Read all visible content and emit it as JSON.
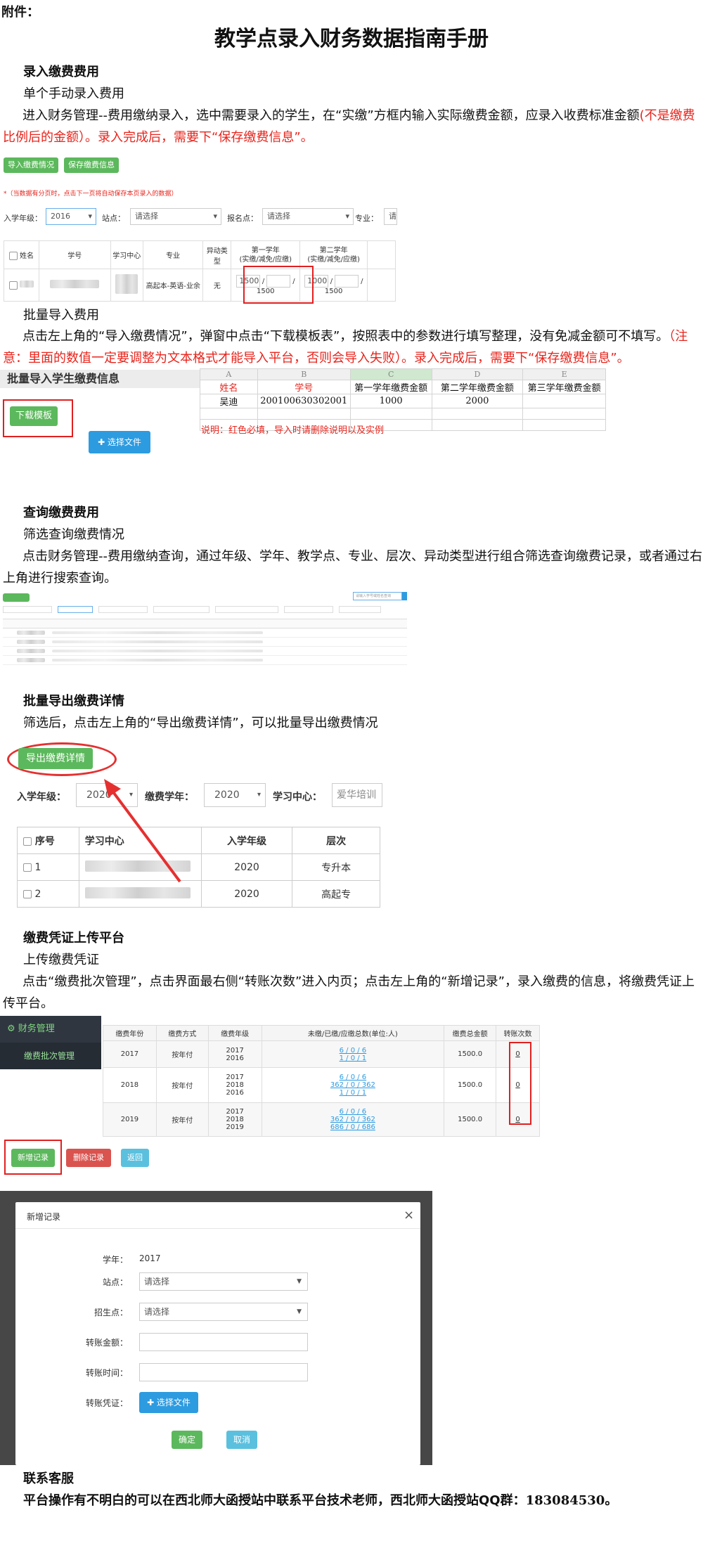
{
  "doc": {
    "attachment": "附件：",
    "title": "教学点录入财务数据指南手册",
    "s1": {
      "heading": "录入缴费费用",
      "sub": "单个手动录入费用",
      "p1": "进入财务管理--费用缴纳录入，选中需要录入的学生，在“实缴”方框内输入实际缴费金额，应录入收费标准金额",
      "p1_red": "(不是缴费比例后的金额）。录入完成后，需要下“保存缴费信息”。",
      "btn_import": "导入缴费情况",
      "btn_save": "保存缴费信息",
      "note": "*（当数据有分页时，点击下一页将自动保存本页录入的数据）",
      "filter": {
        "grade_label": "入学年级：",
        "grade_val": "2016",
        "site_label": "站点：",
        "site_val": "请选择",
        "point_label": "报名点：",
        "point_val": "请选择",
        "major_label": "专业：",
        "major_val": "请"
      },
      "table": {
        "headers": [
          "姓名",
          "学号",
          "学习中心",
          "专业",
          "异动类型",
          "第一学年\n(实缴/减免/应缴)",
          "第二学年\n(实缴/减免/应缴)"
        ],
        "major": "高起本-英语-业余",
        "change": "无",
        "y1_paid": "1500",
        "y1_due": "1500",
        "y2_paid": "1000",
        "y2_due": "1500"
      }
    },
    "s2": {
      "sub": "批量导入费用",
      "p1": "点击左上角的“导入缴费情况”，弹窗中点击“下载模板表”，按照表中的参数进行填写整理，没有免减金额可不填写。",
      "p1_red": "（注意：里面的数值一定要调整为文本格式才能导入平台，否则会导入失败）。录入完成后，需要下“保存缴费信息”。",
      "panel_title": "批量导入学生缴费信息",
      "btn_download": "下载模板",
      "btn_choose": "✚ 选择文件",
      "xl_cols": [
        "A",
        "B",
        "C",
        "D",
        "E"
      ],
      "xl_header": [
        "姓名",
        "学号",
        "第一学年缴费金额",
        "第二学年缴费金额",
        "第三学年缴费金额"
      ],
      "xl_row": [
        "吴迪",
        "200100630302001",
        "1000",
        "2000",
        ""
      ],
      "xl_note": "说明：红色必填，导入时请删除说明以及实例"
    },
    "s3": {
      "heading": "查询缴费费用",
      "sub": "筛选查询缴费情况",
      "p1": "点击财务管理--费用缴纳查询，通过年级、学年、教学点、专业、层次、异动类型进行组合筛选查询缴费记录，或者通过右上角进行搜索查询。",
      "search_placeholder": "请输入学号或姓名查询"
    },
    "s4": {
      "sub": "批量导出缴费详情",
      "p1": "筛选后，点击左上角的“导出缴费详情”，可以批量导出缴费情况",
      "btn_export": "导出缴费详情",
      "grade_label": "入学年级：",
      "grade_val": "2020",
      "year_label": "缴费学年：",
      "year_val": "2020",
      "center_label": "学习中心：",
      "center_val": "爱华培训",
      "headers": [
        "序号",
        "学习中心",
        "入学年级",
        "层次"
      ],
      "rows": [
        {
          "no": "1",
          "grade": "2020",
          "level": "专升本"
        },
        {
          "no": "2",
          "grade": "2020",
          "level": "高起专"
        }
      ]
    },
    "s5": {
      "heading": "缴费凭证上传平台",
      "sub": "上传缴费凭证",
      "p1": "点击“缴费批次管理”，点击界面最右侧“转账次数”进入内页；点击左上角的“新增记录”，录入缴费的信息，将缴费凭证上传平台。",
      "sidebar_main": "财务管理",
      "sidebar_sub": "缴费批次管理",
      "headers": [
        "缴费年份",
        "缴费方式",
        "缴费年级",
        "未缴/已缴/应缴总数(单位:人)",
        "缴费总金额",
        "转账次数"
      ],
      "rows": [
        {
          "year": "2017",
          "method": "按年付",
          "grades": [
            "2017",
            "2016"
          ],
          "counts": [
            "6 / 0 / 6",
            "1 / 0 / 1"
          ],
          "total": "1500.0",
          "transfers": "0"
        },
        {
          "year": "2018",
          "method": "按年付",
          "grades": [
            "2017",
            "2018",
            "2016"
          ],
          "counts": [
            "6 / 0 / 6",
            "362 / 0 / 362",
            "1 / 0 / 1"
          ],
          "total": "1500.0",
          "transfers": "0"
        },
        {
          "year": "2019",
          "method": "按年付",
          "grades": [
            "2017",
            "2018",
            "2019"
          ],
          "counts": [
            "6 / 0 / 6",
            "362 / 0 / 362",
            "686 / 0 / 686"
          ],
          "total": "1500.0",
          "transfers": "0"
        }
      ],
      "btn_add": "新增记录",
      "btn_delete": "删除记录",
      "btn_back": "返回",
      "modal": {
        "title": "新增记录",
        "year_label": "学年：",
        "year_val": "2017",
        "site_label": "站点：",
        "site_val": "请选择",
        "point_label": "招生点：",
        "point_val": "请选择",
        "amount_label": "转账金额：",
        "time_label": "转账时间：",
        "voucher_label": "转账凭证：",
        "choose": "✚ 选择文件",
        "ok": "确定",
        "cancel": "取消"
      }
    },
    "contact": {
      "heading": "联系客服",
      "text": "平台操作有不明白的可以在西北师大函授站中联系平台技术老师，西北师大函授站QQ群：",
      "qq": "183084530。"
    }
  }
}
